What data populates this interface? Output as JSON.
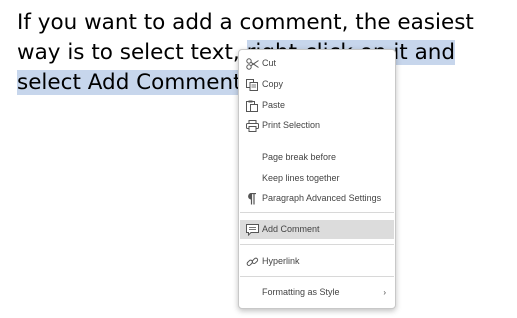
{
  "document": {
    "text_before": "If you want to add a comment, the easiest way is to select text, ",
    "text_selected": "right-click on it and select Add Comment",
    "text_after": "."
  },
  "context_menu": {
    "items": [
      {
        "label": "Cut",
        "icon": "scissors-icon"
      },
      {
        "label": "Copy",
        "icon": "copy-icon"
      },
      {
        "label": "Paste",
        "icon": "paste-icon"
      },
      {
        "label": "Print Selection",
        "icon": "printer-icon"
      },
      {
        "label": "Page break before",
        "icon": ""
      },
      {
        "label": "Keep lines together",
        "icon": ""
      },
      {
        "label": "Paragraph Advanced Settings",
        "icon": "paragraph-icon"
      },
      {
        "label": "Add Comment",
        "icon": "comment-icon",
        "highlighted": true
      },
      {
        "label": "Hyperlink",
        "icon": "link-icon"
      },
      {
        "label": "Formatting as Style",
        "icon": "",
        "submenu_arrow": "›"
      }
    ]
  },
  "colors": {
    "selection": "#c7d6ec",
    "menu_highlight": "#dcdcdc"
  }
}
